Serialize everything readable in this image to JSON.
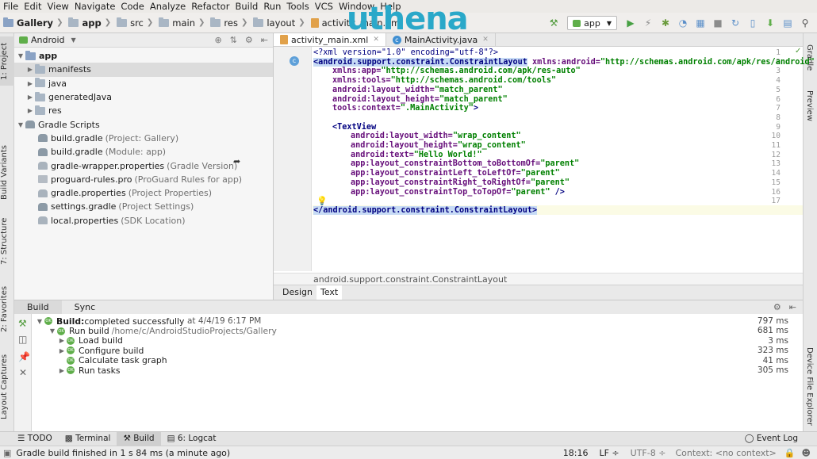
{
  "menu": [
    "File",
    "Edit",
    "View",
    "Navigate",
    "Code",
    "Analyze",
    "Refactor",
    "Build",
    "Run",
    "Tools",
    "VCS",
    "Window",
    "Help"
  ],
  "navbar": {
    "crumbs": [
      "Gallery",
      "app",
      "src",
      "main",
      "res",
      "layout",
      "activity_main.xml"
    ]
  },
  "watermark": {
    "text": "uthena"
  },
  "toolbar": {
    "run_config": "app"
  },
  "left_strip": {
    "project": "1: Project",
    "build_variants": "Build Variants",
    "structure": "7: Structure",
    "favorites": "2: Favorites",
    "captures": "Layout Captures"
  },
  "right_strip": {
    "gradle": "Gradle",
    "preview": "Preview",
    "device_explorer": "Device File Explorer"
  },
  "project": {
    "view_selector": "Android",
    "tree": [
      {
        "label": "app",
        "hint": ""
      },
      {
        "label": "manifests",
        "hint": ""
      },
      {
        "label": "java",
        "hint": ""
      },
      {
        "label": "generatedJava",
        "hint": ""
      },
      {
        "label": "res",
        "hint": ""
      },
      {
        "label": "Gradle Scripts",
        "hint": ""
      },
      {
        "label": "build.gradle",
        "hint": "(Project: Gallery)"
      },
      {
        "label": "build.gradle",
        "hint": "(Module: app)"
      },
      {
        "label": "gradle-wrapper.properties",
        "hint": "(Gradle Version)"
      },
      {
        "label": "proguard-rules.pro",
        "hint": "(ProGuard Rules for app)"
      },
      {
        "label": "gradle.properties",
        "hint": "(Project Properties)"
      },
      {
        "label": "settings.gradle",
        "hint": "(Project Settings)"
      },
      {
        "label": "local.properties",
        "hint": "(SDK Location)"
      }
    ]
  },
  "editor": {
    "tabs": [
      "activity_main.xml",
      "MainActivity.java"
    ],
    "line_numbers": [
      "1",
      "2",
      "3",
      "4",
      "5",
      "6",
      "7",
      "8",
      "9",
      "10",
      "11",
      "12",
      "13",
      "14",
      "15",
      "16",
      "17",
      "18"
    ],
    "code": {
      "l1": "<?xml version=\"1.0\" encoding=\"utf-8\"?>",
      "l2_tag": "<android.support.constraint.ConstraintLayout",
      "l2_attr": " xmlns:android=",
      "l2_val": "\"http://schemas.android.com/apk/res/android\"",
      "l3_attr": "xmlns:app=",
      "l3_val": "\"http://schemas.android.com/apk/res-auto\"",
      "l4_attr": "xmlns:tools=",
      "l4_val": "\"http://schemas.android.com/tools\"",
      "l5_attr": "android:layout_width=",
      "l5_val": "\"match_parent\"",
      "l6_attr": "android:layout_height=",
      "l6_val": "\"match_parent\"",
      "l7_attr": "tools:context=",
      "l7_val": "\".MainActivity\"",
      "l7_end": ">",
      "l9_tag": "<TextView",
      "l10_attr": "android:layout_width=",
      "l10_val": "\"wrap_content\"",
      "l11_attr": "android:layout_height=",
      "l11_val": "\"wrap_content\"",
      "l12_attr": "android:text=",
      "l12_val": "\"Hello World!\"",
      "l13_attr": "app:layout_constraintBottom_toBottomOf=",
      "l13_val": "\"parent\"",
      "l14_attr": "app:layout_constraintLeft_toLeftOf=",
      "l14_val": "\"parent\"",
      "l15_attr": "app:layout_constraintRight_toRightOf=",
      "l15_val": "\"parent\"",
      "l16_attr": "app:layout_constraintTop_toTopOf=",
      "l16_val": "\"parent\"",
      "l16_end": " />",
      "l18_tag": "</android.support.constraint.ConstraintLayout>"
    },
    "breadcrumb": "android.support.constraint.ConstraintLayout",
    "design_tabs": [
      "Design",
      "Text"
    ]
  },
  "build": {
    "tabs": [
      "Build",
      "Sync"
    ],
    "rows": [
      {
        "label": "Build:",
        "rest": " completed successfully",
        "extra": "at 4/4/19 6:17 PM",
        "time": "797 ms"
      },
      {
        "label": "Run build",
        "rest": "",
        "extra": "/home/c/AndroidStudioProjects/Gallery",
        "time": "681 ms"
      },
      {
        "label": "Load build",
        "rest": "",
        "extra": "",
        "time": "3 ms"
      },
      {
        "label": "Configure build",
        "rest": "",
        "extra": "",
        "time": "323 ms"
      },
      {
        "label": "Calculate task graph",
        "rest": "",
        "extra": "",
        "time": "41 ms"
      },
      {
        "label": "Run tasks",
        "rest": "",
        "extra": "",
        "time": "305 ms"
      }
    ]
  },
  "toolwindows": {
    "todo": "TODO",
    "terminal": "Terminal",
    "build": "Build",
    "logcat": "6: Logcat",
    "event_log": "Event Log"
  },
  "status": {
    "message": "Gradle build finished in 1 s 84 ms (a minute ago)",
    "position": "18:16",
    "line_sep": "LF ÷",
    "encoding": "UTF-8 ÷",
    "context": "Context: <no context>"
  }
}
